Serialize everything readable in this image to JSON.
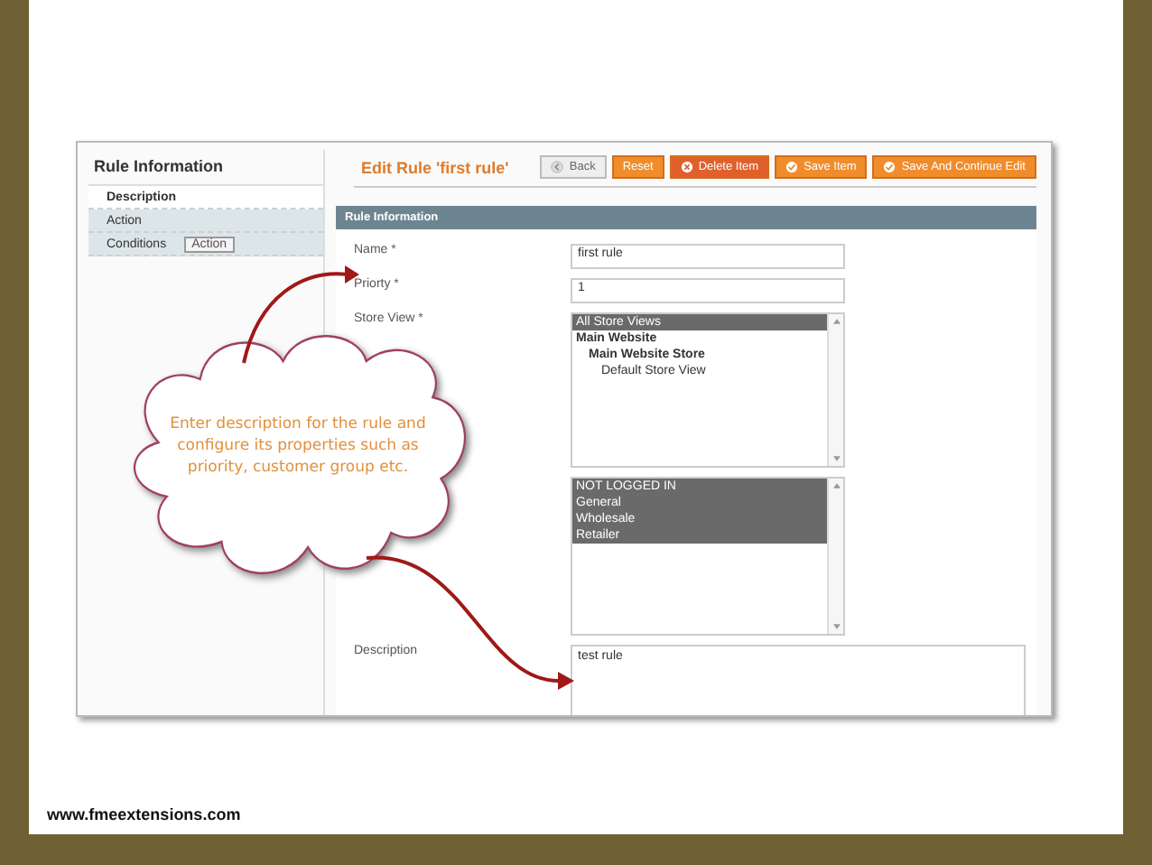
{
  "sidebar": {
    "title": "Rule Information",
    "tabs": [
      {
        "label": "Description",
        "selected": true
      },
      {
        "label": "Action",
        "selected": false
      },
      {
        "label": "Conditions",
        "selected": false
      }
    ],
    "tooltip": "Action"
  },
  "page_title": "Edit Rule 'first rule'",
  "buttons": [
    {
      "label": "Back",
      "kind": "plain"
    },
    {
      "label": "Reset",
      "kind": "orange"
    },
    {
      "label": "Delete Item",
      "kind": "danger"
    },
    {
      "label": "Save Item",
      "kind": "save"
    },
    {
      "label": "Save And Continue Edit",
      "kind": "save"
    }
  ],
  "section_title": "Rule Information",
  "form": {
    "name": {
      "label": "Name *",
      "value": "first rule"
    },
    "priority": {
      "label": "Priorty *",
      "value": "1"
    },
    "store_view": {
      "label": "Store View *",
      "options": [
        {
          "label": "All Store Views",
          "selected": true
        },
        {
          "label": "Main Website",
          "selected": false,
          "children": [
            {
              "label": "Main Website Store",
              "selected": false,
              "children": [
                {
                  "label": "Default Store View",
                  "selected": false
                }
              ]
            }
          ]
        }
      ]
    },
    "customer_groups": {
      "options": [
        {
          "label": "NOT LOGGED IN",
          "selected": true
        },
        {
          "label": "General",
          "selected": true
        },
        {
          "label": "Wholesale",
          "selected": true
        },
        {
          "label": "Retailer",
          "selected": true
        }
      ]
    },
    "description": {
      "label": "Description",
      "value": "test rule"
    }
  },
  "callout": "Enter description for the rule and configure its properties such as priority, customer group etc.",
  "footer": "www.fmeextensions.com"
}
